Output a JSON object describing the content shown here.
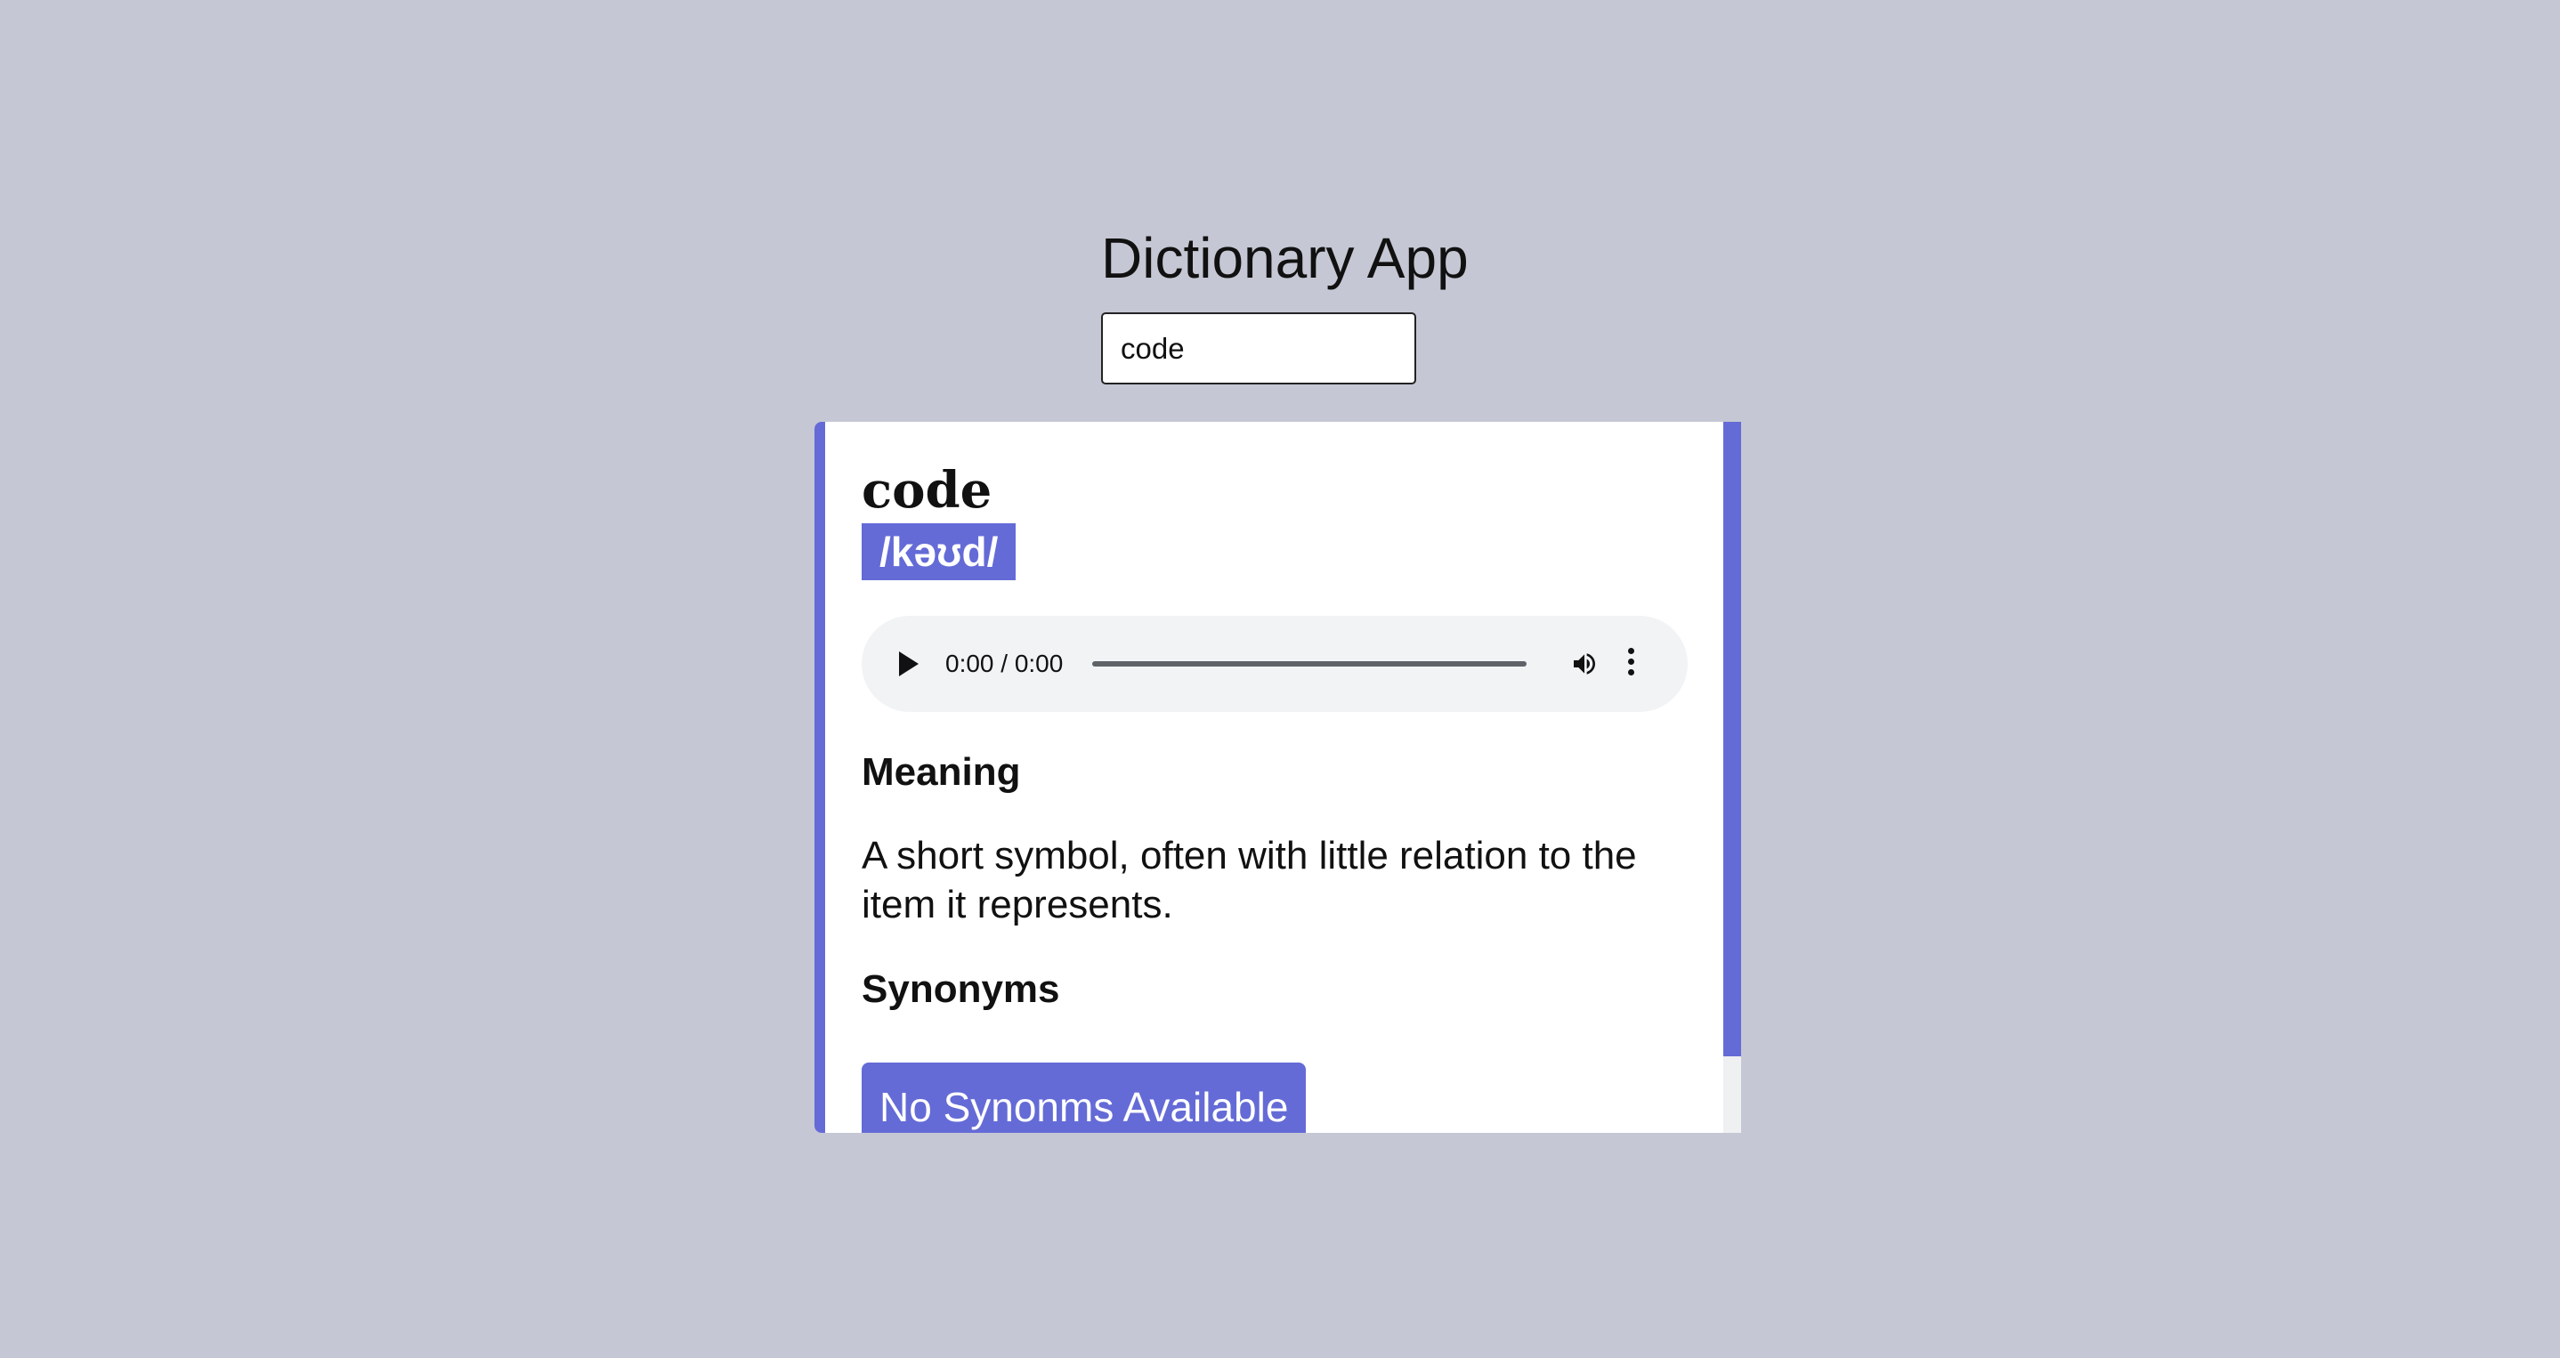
{
  "app": {
    "title": "Dictionary App"
  },
  "search": {
    "value": "code"
  },
  "result": {
    "word": "code",
    "phonetic": "/kəʊd/",
    "audio": {
      "time_display": "0:00 / 0:00"
    },
    "meaning_heading": "Meaning",
    "definition": "A short symbol, often with little relation to the item it represents.",
    "synonyms_heading": "Synonyms",
    "synonyms_empty_label": "No Synonms Available"
  },
  "colors": {
    "background": "#c5c7d4",
    "accent": "#646bd6",
    "card": "#ffffff"
  },
  "icons": {
    "play": "play-icon",
    "volume": "volume-icon",
    "more": "more-options-icon"
  }
}
